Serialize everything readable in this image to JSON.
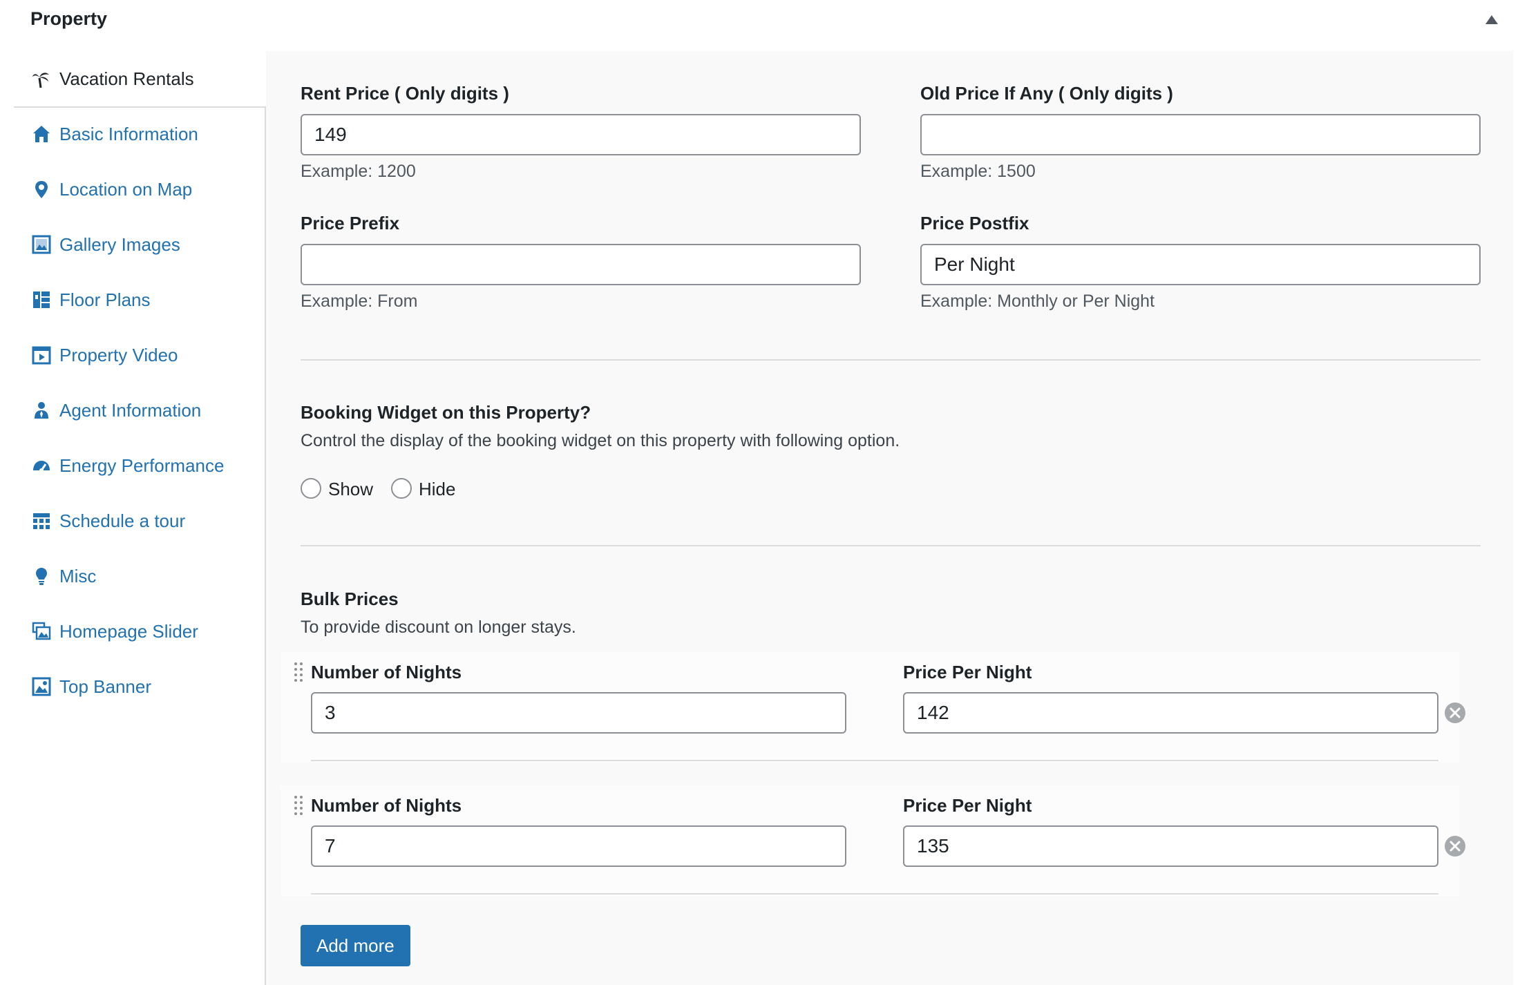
{
  "header": {
    "title": "Property"
  },
  "sidebar": {
    "items": [
      {
        "label": "Vacation Rentals",
        "icon": "palm-tree-icon"
      },
      {
        "label": "Basic Information",
        "icon": "home-icon"
      },
      {
        "label": "Location on Map",
        "icon": "location-pin-icon"
      },
      {
        "label": "Gallery Images",
        "icon": "gallery-icon"
      },
      {
        "label": "Floor Plans",
        "icon": "floor-plan-icon"
      },
      {
        "label": "Property Video",
        "icon": "video-icon"
      },
      {
        "label": "Agent Information",
        "icon": "agent-icon"
      },
      {
        "label": "Energy Performance",
        "icon": "dashboard-gauge-icon"
      },
      {
        "label": "Schedule a tour",
        "icon": "schedule-grid-icon"
      },
      {
        "label": "Misc",
        "icon": "lightbulb-icon"
      },
      {
        "label": "Homepage Slider",
        "icon": "slides-icon"
      },
      {
        "label": "Top Banner",
        "icon": "banner-image-icon"
      }
    ]
  },
  "pricing": {
    "rent_price": {
      "label": "Rent Price ( Only digits )",
      "value": "149",
      "hint": "Example: 1200"
    },
    "old_price": {
      "label": "Old Price If Any ( Only digits )",
      "value": "",
      "hint": "Example: 1500"
    },
    "price_prefix": {
      "label": "Price Prefix",
      "value": "",
      "hint": "Example: From"
    },
    "price_postfix": {
      "label": "Price Postfix",
      "value": "Per Night",
      "hint": "Example: Monthly or Per Night"
    }
  },
  "booking_widget": {
    "title": "Booking Widget on this Property?",
    "description": "Control the display of the booking widget on this property with following option.",
    "options": [
      "Show",
      "Hide"
    ]
  },
  "bulk_prices": {
    "title": "Bulk Prices",
    "description": "To provide discount on longer stays.",
    "nights_label": "Number of Nights",
    "price_label": "Price Per Night",
    "rows": [
      {
        "nights": "3",
        "price": "142"
      },
      {
        "nights": "7",
        "price": "135"
      }
    ],
    "add_label": "Add more"
  },
  "colors": {
    "link": "#2271b1",
    "primary_button": "#2271b1",
    "text": "#1d2327",
    "border": "#8c8f94"
  }
}
